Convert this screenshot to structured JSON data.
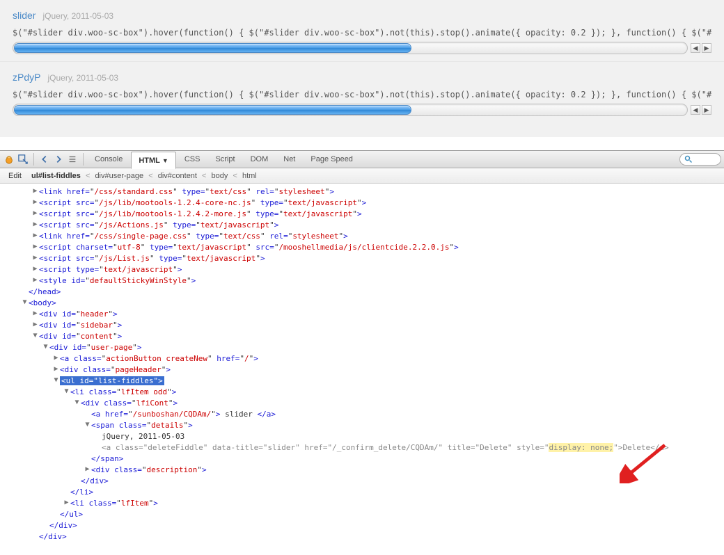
{
  "fiddles": [
    {
      "title": "slider",
      "meta": "jQuery, 2011-05-03",
      "code": "$(\"#slider div.woo-sc-box\").hover(function() { $(\"#slider div.woo-sc-box\").not(this).stop().animate({ opacity: 0.2 }); }, function() { $(\"#slider d"
    },
    {
      "title": "zPdyP",
      "meta": "jQuery, 2011-05-03",
      "code": "$(\"#slider div.woo-sc-box\").hover(function() { $(\"#slider div.woo-sc-box\").not(this).stop().animate({ opacity: 0.2 }); }, function() { $(\"#slider d"
    }
  ],
  "toolbar": {
    "tabs": {
      "console": "Console",
      "html": "HTML",
      "css": "CSS",
      "script": "Script",
      "dom": "DOM",
      "net": "Net",
      "pagespeed": "Page Speed"
    },
    "search_placeholder": ""
  },
  "subbar": {
    "edit": "Edit",
    "crumbs": [
      "ul#list-fiddles",
      "div#user-page",
      "div#content",
      "body",
      "html"
    ]
  },
  "dom": {
    "l1": {
      "tag": "link",
      "attrs": [
        [
          "href",
          "/css/standard.css"
        ],
        [
          "type",
          "text/css"
        ],
        [
          "rel",
          "stylesheet"
        ]
      ]
    },
    "l2": {
      "tag": "script",
      "attrs": [
        [
          "src",
          "/js/lib/mootools-1.2.4-core-nc.js"
        ],
        [
          "type",
          "text/javascript"
        ]
      ]
    },
    "l3": {
      "tag": "script",
      "attrs": [
        [
          "src",
          "/js/lib/mootools-1.2.4.2-more.js"
        ],
        [
          "type",
          "text/javascript"
        ]
      ]
    },
    "l4": {
      "tag": "script",
      "attrs": [
        [
          "src",
          "/js/Actions.js"
        ],
        [
          "type",
          "text/javascript"
        ]
      ]
    },
    "l5": {
      "tag": "link",
      "attrs": [
        [
          "href",
          "/css/single-page.css"
        ],
        [
          "type",
          "text/css"
        ],
        [
          "rel",
          "stylesheet"
        ]
      ]
    },
    "l6": {
      "tag": "script",
      "attrs": [
        [
          "charset",
          "utf-8"
        ],
        [
          "type",
          "text/javascript"
        ],
        [
          "src",
          "/mooshellmedia/js/clientcide.2.2.0.js"
        ]
      ]
    },
    "l7": {
      "tag": "script",
      "attrs": [
        [
          "src",
          "/js/List.js"
        ],
        [
          "type",
          "text/javascript"
        ]
      ]
    },
    "l8": {
      "tag": "script",
      "attrs": [
        [
          "type",
          "text/javascript"
        ]
      ]
    },
    "l9": {
      "tag": "style",
      "attrs": [
        [
          "id",
          "defaultStickyWinStyle"
        ]
      ]
    },
    "headclose": "</head>",
    "body": "<body>",
    "d_header": {
      "tag": "div",
      "attrs": [
        [
          "id",
          "header"
        ]
      ]
    },
    "d_sidebar": {
      "tag": "div",
      "attrs": [
        [
          "id",
          "sidebar"
        ]
      ]
    },
    "d_content": {
      "tag": "div",
      "attrs": [
        [
          "id",
          "content"
        ]
      ]
    },
    "d_userpage": {
      "tag": "div",
      "attrs": [
        [
          "id",
          "user-page"
        ]
      ]
    },
    "a_create": {
      "tag": "a",
      "attrs": [
        [
          "class",
          "actionButton createNew"
        ],
        [
          "href",
          "/"
        ]
      ]
    },
    "d_pagehdr": {
      "tag": "div",
      "attrs": [
        [
          "class",
          "pageHeader"
        ]
      ]
    },
    "ul_list": {
      "tag": "ul",
      "attrs": [
        [
          "id",
          "list-fiddles"
        ]
      ]
    },
    "li_odd": {
      "tag": "li",
      "attrs": [
        [
          "class",
          "lfItem odd"
        ]
      ]
    },
    "d_lficont": {
      "tag": "div",
      "attrs": [
        [
          "class",
          "lfiCont"
        ]
      ]
    },
    "a_slider": {
      "tag": "a",
      "attrs": [
        [
          "href",
          "/sunboshan/CQDAm/"
        ]
      ],
      "text": " slider ",
      "close": "</a>"
    },
    "span_details": {
      "tag": "span",
      "attrs": [
        [
          "class",
          "details"
        ]
      ]
    },
    "details_text": "jQuery, 2011-05-03",
    "a_delete": {
      "tag": "a",
      "attrs": [
        [
          "class",
          "deleteFiddle"
        ],
        [
          "data-title",
          "slider"
        ],
        [
          "href",
          "/_confirm_delete/CQDAm/"
        ],
        [
          "title",
          "Delete"
        ],
        [
          "style",
          "display: none;"
        ]
      ],
      "text": "Delete",
      "close": "</a>"
    },
    "span_close": "</span>",
    "d_desc": {
      "tag": "div",
      "attrs": [
        [
          "class",
          "description"
        ]
      ]
    },
    "div_close": "</div>",
    "li_close": "</li>",
    "li_item": {
      "tag": "li",
      "attrs": [
        [
          "class",
          "lfItem"
        ]
      ]
    },
    "ul_close": "</ul>"
  }
}
